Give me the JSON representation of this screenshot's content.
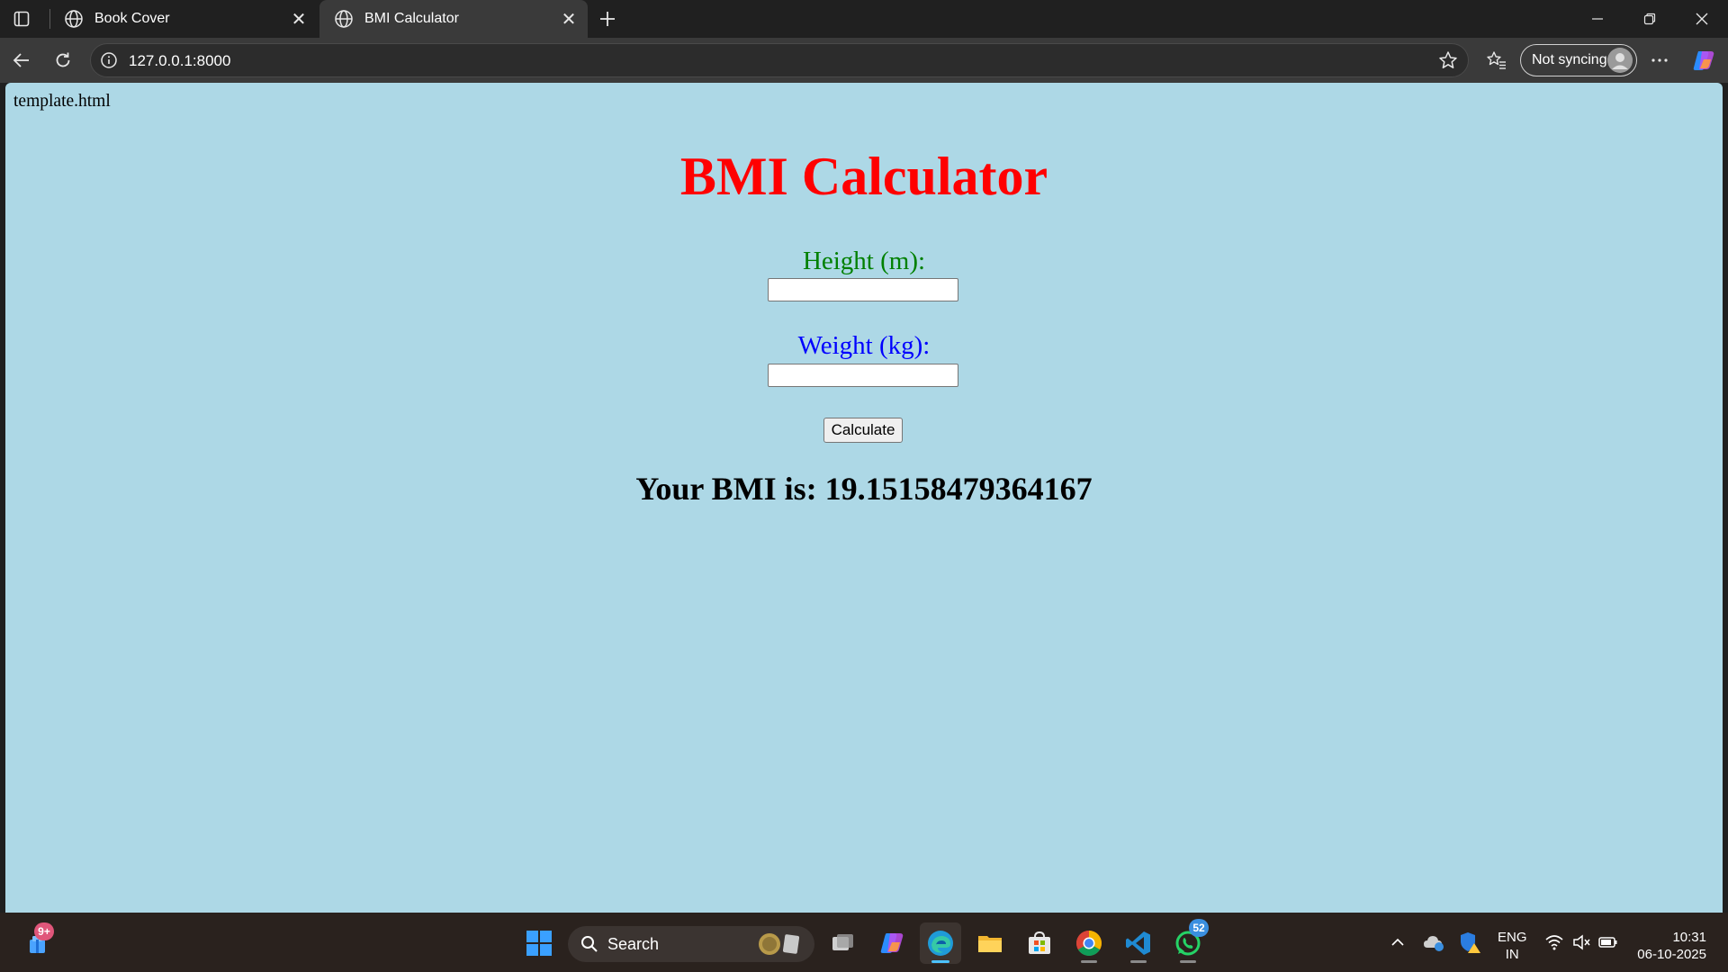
{
  "browser": {
    "tabs": [
      {
        "title": "Book Cover",
        "active": false
      },
      {
        "title": "BMI Calculator",
        "active": true
      }
    ],
    "url": "127.0.0.1:8000",
    "sync_label": "Not syncing"
  },
  "page": {
    "file_label": "template.html",
    "title": "BMI Calculator",
    "height_label": "Height (m):",
    "weight_label": "Weight (kg):",
    "height_value": "",
    "weight_value": "",
    "calculate_label": "Calculate",
    "result_text": "Your BMI is: 19.15158479364167"
  },
  "colors": {
    "page_background": "#add8e6",
    "title": "#ff0000",
    "height_label": "#008000",
    "weight_label": "#0000ff"
  },
  "taskbar": {
    "widgets_badge": "9+",
    "search_label": "Search",
    "whatsapp_badge": "52",
    "language": "ENG",
    "region": "IN",
    "time": "10:31",
    "date": "06-10-2025"
  }
}
